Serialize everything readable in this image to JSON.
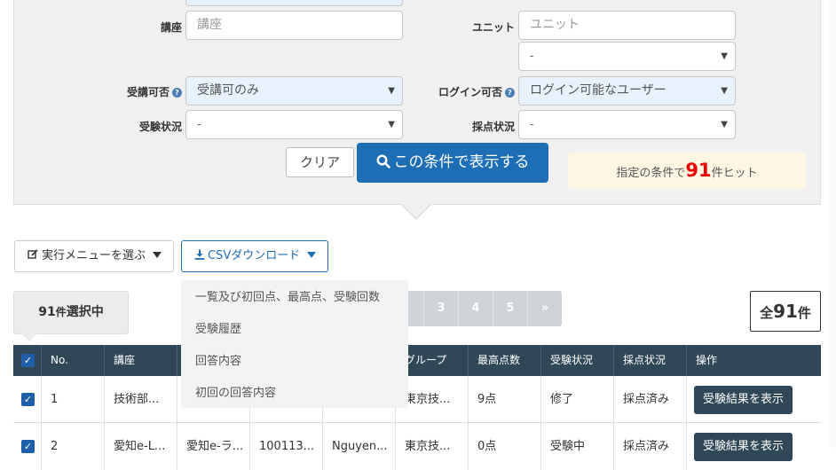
{
  "filters": {
    "course": {
      "label": "講座",
      "placeholder": "講座"
    },
    "unit": {
      "label": "ユニット",
      "placeholder": "ユニット",
      "sub_value": "-"
    },
    "enroll": {
      "label": "受講可否",
      "value": "受講可のみ"
    },
    "login": {
      "label": "ログイン可否",
      "value": "ログイン可能なユーザー"
    },
    "exam_status": {
      "label": "受験状況",
      "value": "-"
    },
    "grading_status": {
      "label": "採点状況",
      "value": "-"
    }
  },
  "actions": {
    "clear": "クリア",
    "search": "この条件で表示する",
    "hit_prefix": "指定の条件で",
    "hit_count": "91",
    "hit_suffix": "件ヒット"
  },
  "toolbar": {
    "menu": "実行メニューを選ぶ",
    "csv": "CSVダウンロード"
  },
  "csv_menu": [
    "一覧及び初回点、最高点、受験回数",
    "受験履歴",
    "回答内容",
    "初回の回答内容"
  ],
  "selection": {
    "count": "91",
    "unit": "件",
    "label": "選択中"
  },
  "pager": [
    "3",
    "4",
    "5",
    "»"
  ],
  "total": {
    "prefix": "全",
    "count": "91",
    "unit": "件"
  },
  "table": {
    "headers": [
      "No.",
      "講座",
      "",
      "",
      "",
      "グループ",
      "最高点数",
      "受験状況",
      "採点状況",
      "操作"
    ],
    "rows": [
      {
        "no": "1",
        "course": "技術部...",
        "c3": "",
        "c4": "",
        "c5": "",
        "group": "東京技...",
        "score": "9点",
        "exam": "修了",
        "grading": "採点済み",
        "op": "受験結果を表示"
      },
      {
        "no": "2",
        "course": "愛知e-L...",
        "c3": "愛知e-ラ...",
        "c4": "100113...",
        "c5": "Nguyen...",
        "group": "東京技...",
        "score": "0点",
        "exam": "受験中",
        "grading": "採点済み",
        "op": "受験結果を表示"
      }
    ]
  }
}
